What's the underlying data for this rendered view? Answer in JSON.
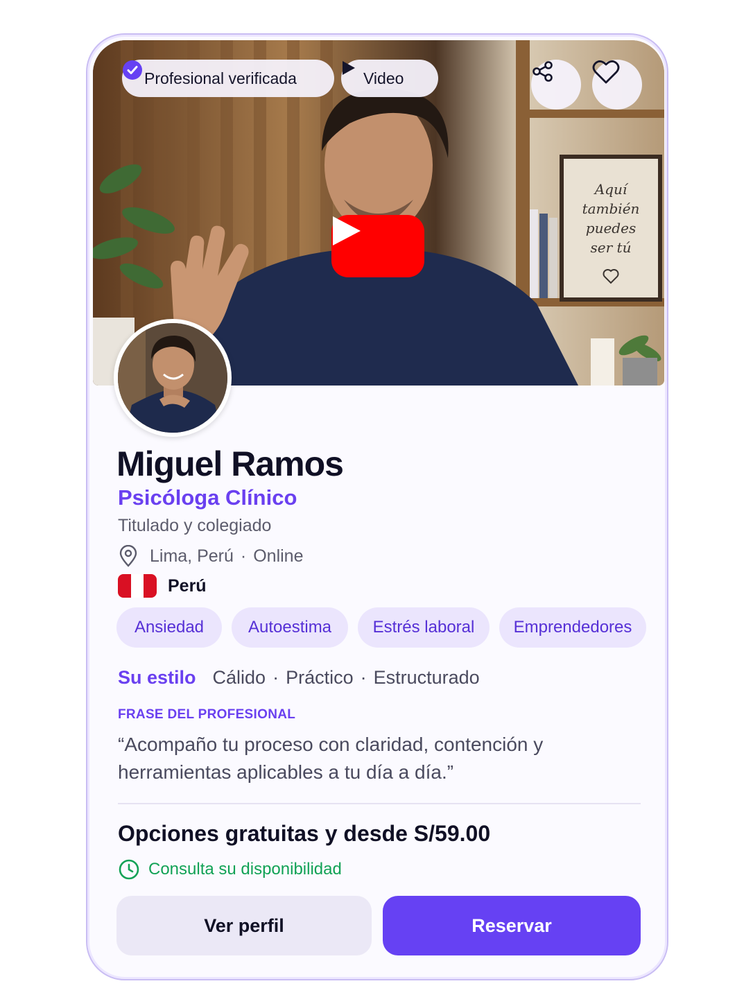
{
  "badges": {
    "verified_label": "Profesional verificada",
    "video_label": "Video"
  },
  "hero": {
    "frame_text": "Aquí también puedes ser tú"
  },
  "profile": {
    "name": "Miguel Ramos",
    "role": "Psicóloga Clínico",
    "credentials": "Titulado y colegiado",
    "city": "Lima, Perú",
    "separator": "·",
    "modality": "Online",
    "country": "Perú"
  },
  "tags": [
    "Ansiedad",
    "Autoestima",
    "Estrés laboral",
    "Emprendedores"
  ],
  "style": {
    "label": "Su estilo",
    "items": [
      "Cálido",
      "Práctico",
      "Estructurado"
    ]
  },
  "phrase": {
    "heading": "FRASE DEL PROFESIONAL",
    "text": "“Acompaño tu proceso con claridad, contención y herramientas aplicables a tu día a día.”"
  },
  "pricing": {
    "text": "Opciones gratuitas y desde S/59.00",
    "availability": "Consulta su disponibilidad"
  },
  "actions": {
    "profile_label": "Ver perfil",
    "book_label": "Reservar"
  },
  "colors": {
    "accent": "#6641f3",
    "tag_bg": "#ebe5fd",
    "success": "#12a256",
    "youtube_red": "#ff0000",
    "flag_red": "#d91023"
  },
  "icons": [
    "verified-check-icon",
    "play-icon",
    "share-icon",
    "heart-icon",
    "youtube-play-icon",
    "location-pin-icon",
    "clock-icon"
  ]
}
